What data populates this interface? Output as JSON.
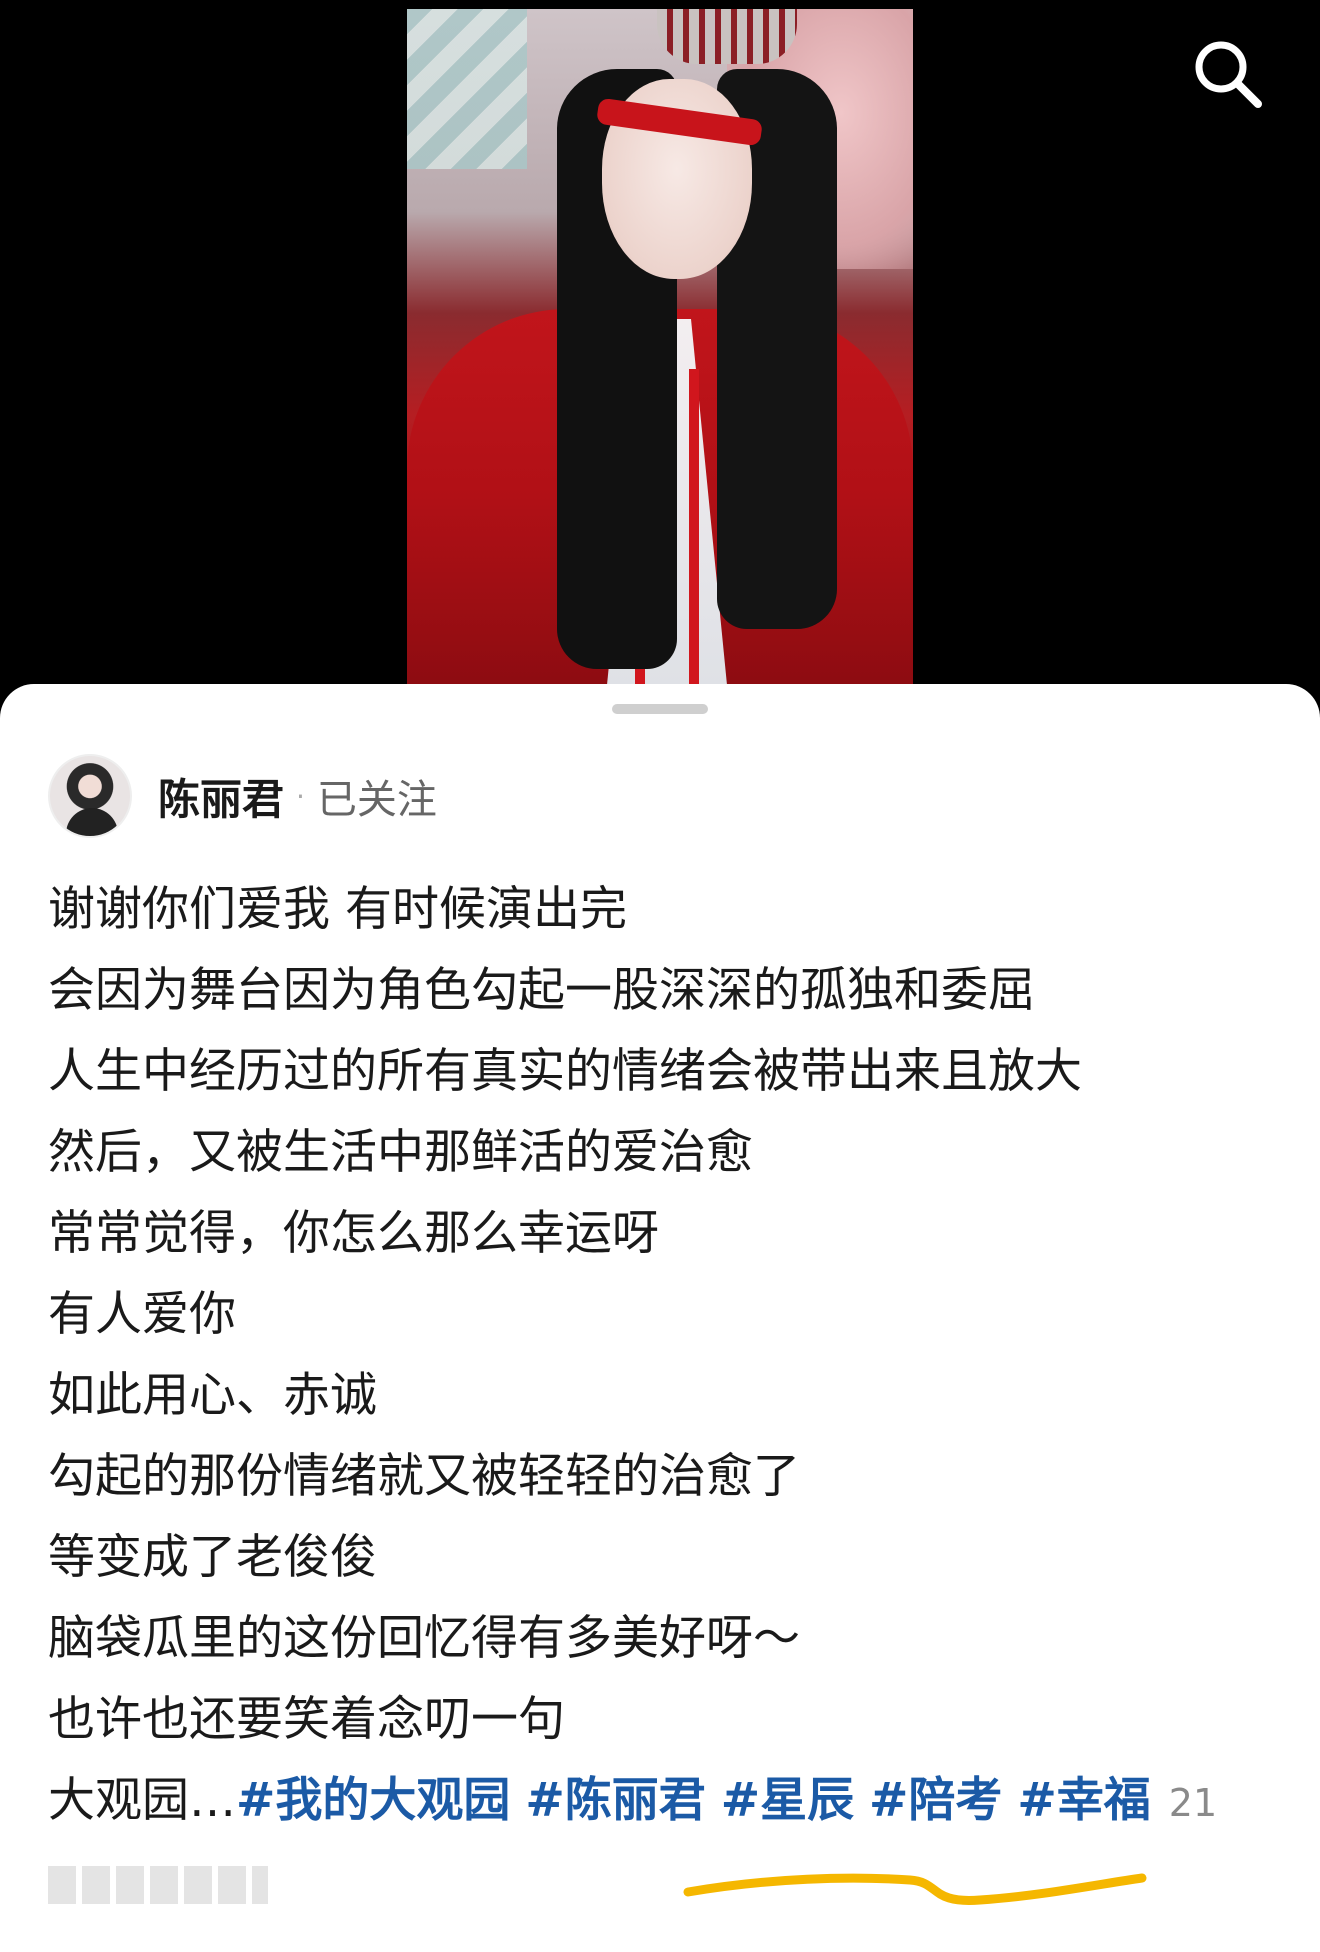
{
  "viewer": {
    "search_icon": "search-icon"
  },
  "author": {
    "name": "陈丽君",
    "follow_status": "已关注"
  },
  "post": {
    "lines": [
      "谢谢你们爱我 有时候演出完",
      "会因为舞台因为角色勾起一股深深的孤独和委屈",
      "人生中经历过的所有真实的情绪会被带出来且放大",
      "然后，又被生活中那鲜活的爱治愈",
      "常常觉得，你怎么那么幸运呀",
      "有人爱你",
      "如此用心、赤诚",
      "勾起的那份情绪就又被轻轻的治愈了",
      "等变成了老俊俊",
      "脑袋瓜里的这份回忆得有多美好呀～",
      "也许也还要笑着念叨一句"
    ],
    "last_line_prefix": "大观园…",
    "hashtags": [
      "#我的大观园",
      "#陈丽君",
      "#星辰",
      "#陪考",
      "#幸福"
    ],
    "trailing_count": "21"
  },
  "colors": {
    "hashtag": "#1b5aa6",
    "annotation_underline": "#f5b700"
  }
}
